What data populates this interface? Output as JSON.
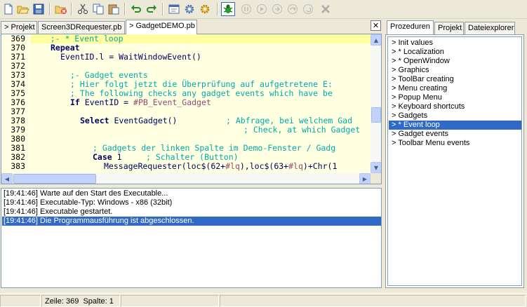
{
  "toolbar": {
    "buttons": [
      "new-file",
      "open-file",
      "save-file",
      "close-file",
      "cut",
      "copy",
      "paste",
      "undo",
      "redo",
      "project-options",
      "compile-options",
      "build",
      "debugger",
      "pause",
      "continue",
      "step",
      "step-over",
      "step-out",
      "kill"
    ]
  },
  "tabs": [
    {
      "label": "Projekt"
    },
    {
      "label": "Screen3DRequester.pb"
    },
    {
      "label": "GadgetDEMO.pb"
    }
  ],
  "close_label": "✕",
  "editor": {
    "lines": [
      {
        "num": "369"
      },
      {
        "num": "370"
      },
      {
        "num": "371"
      },
      {
        "num": "372"
      },
      {
        "num": "373"
      },
      {
        "num": "374"
      },
      {
        "num": "375"
      },
      {
        "num": "376"
      },
      {
        "num": "377"
      },
      {
        "num": "378"
      },
      {
        "num": "379"
      },
      {
        "num": "380"
      },
      {
        "num": "381"
      },
      {
        "num": "382"
      },
      {
        "num": "383"
      }
    ],
    "code": {
      "l369": "    ;- * Event loop",
      "l370_kw": "Repeat",
      "l371_a": "EventID.l = ",
      "l371_b": "WaitWindowEvent()",
      "l373": ";- Gadget events",
      "l374": "; Hier folgt jetzt die Überprüfung auf aufgetretene E:",
      "l375": "; The following checks any gadget events which have be",
      "l376_kw": "If",
      "l376_a": " EventID = ",
      "l376_c": "#PB_Event_Gadget",
      "l378_kw": "Select",
      "l378_a": " EventGadget()",
      "l378_c": "; Abfrage, bei welchem Gad",
      "l379_c": "; Check, at which Gadget",
      "l381_c": "; Gadgets der linken Spalte im Demo-Fenster / Gadg",
      "l382_kw": "Case",
      "l382_a": " 1",
      "l382_c": "; Schalter (Button)",
      "l383_a": "MessageRequester(loc$(62+",
      "l383_c1": "#lq",
      "l383_b": "),loc$(63+",
      "l383_c2": "#lq",
      "l383_d": ")+Chr(1"
    }
  },
  "output": [
    {
      "time": "[19:41:46]",
      "text": "Warte auf den Start des Executable..."
    },
    {
      "time": "[19:41:46]",
      "text": "Executable-Typ: Windows - x86  (32bit)"
    },
    {
      "time": "[19:41:46]",
      "text": "Executable gestartet."
    },
    {
      "time": "[19:41:46]",
      "text": "Die Programmausführung ist abgeschlossen."
    }
  ],
  "right_tabs": [
    {
      "label": "Prozeduren"
    },
    {
      "label": "Projekt"
    },
    {
      "label": "Dateiexplorer"
    }
  ],
  "procedures": [
    {
      "label": "> Init values"
    },
    {
      "label": "> * Localization"
    },
    {
      "label": "> * OpenWindow"
    },
    {
      "label": "> Graphics"
    },
    {
      "label": "> ToolBar creating"
    },
    {
      "label": "> Menu creating"
    },
    {
      "label": "> Popup Menu"
    },
    {
      "label": "> Keyboard shortcuts"
    },
    {
      "label": "> Gadgets"
    },
    {
      "label": "> * Event loop"
    },
    {
      "label": "> Gadget events"
    },
    {
      "label": "> Toolbar Menu events"
    }
  ],
  "status": {
    "line_label": "Zeile: 369",
    "col_label": "Spalte: 1"
  },
  "colors": {
    "editor_bg": "#ffffe1",
    "current_line": "#ffffa0",
    "keyword": "#000066",
    "comment": "#00aaaa",
    "constant": "#924b72",
    "selection": "#316ac5"
  }
}
